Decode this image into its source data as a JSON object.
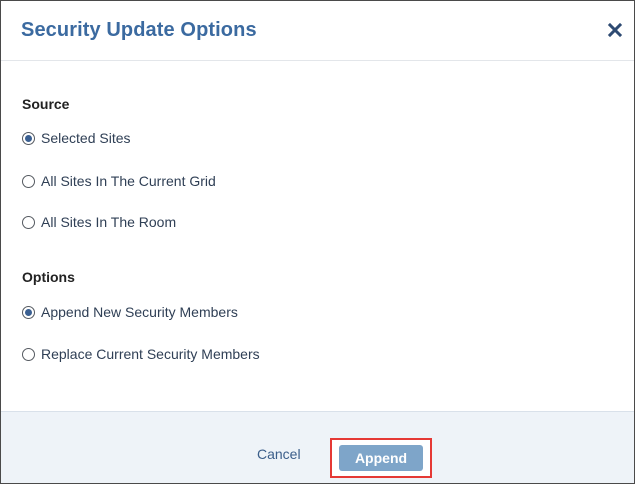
{
  "dialog": {
    "title": "Security Update Options",
    "close_icon": "close-icon"
  },
  "source": {
    "label": "Source",
    "options": [
      {
        "label": "Selected Sites",
        "selected": true
      },
      {
        "label": "All Sites In The Current Grid",
        "selected": false
      },
      {
        "label": "All Sites In The Room",
        "selected": false
      }
    ]
  },
  "options": {
    "label": "Options",
    "options": [
      {
        "label": "Append New Security Members",
        "selected": true
      },
      {
        "label": "Replace Current Security Members",
        "selected": false
      }
    ]
  },
  "footer": {
    "cancel_label": "Cancel",
    "append_label": "Append"
  },
  "colors": {
    "title": "#3b6aa0",
    "footer_bg": "#eef3f8",
    "append_bg": "#7ea5c9",
    "highlight": "#e53935"
  }
}
